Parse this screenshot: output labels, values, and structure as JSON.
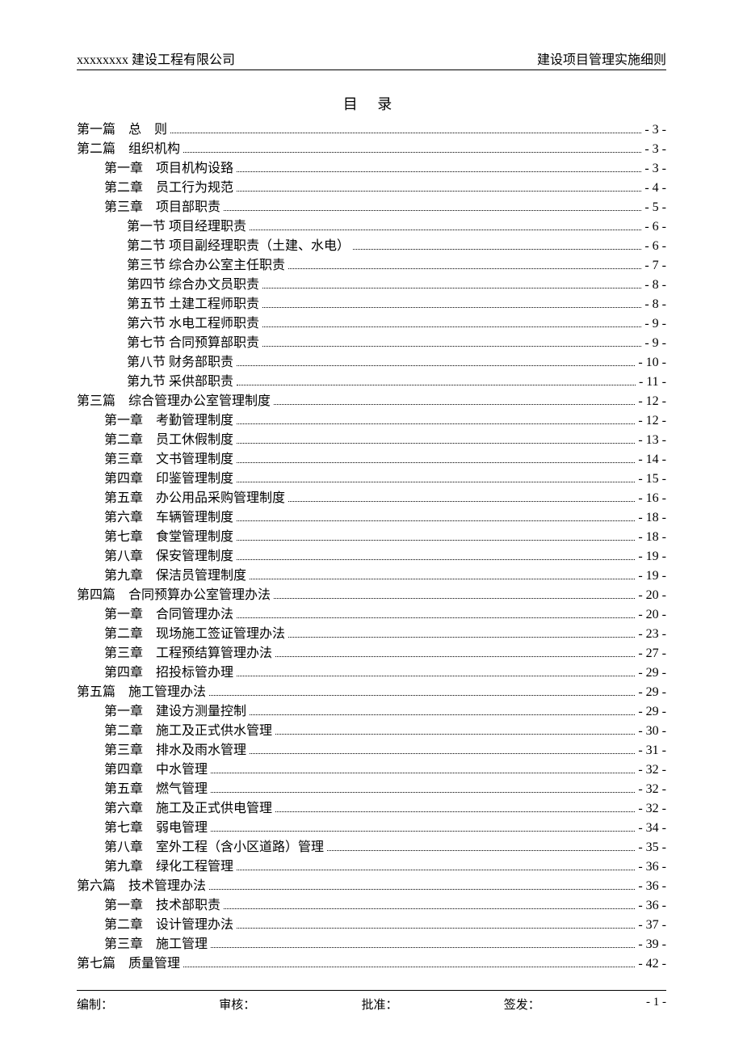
{
  "header": {
    "left": "xxxxxxxx 建设工程有限公司",
    "right": "建设项目管理实施细则"
  },
  "title": "目  录",
  "toc": [
    {
      "indent": 0,
      "label": "第一篇　总　则 ",
      "page": "- 3 -"
    },
    {
      "indent": 0,
      "label": "第二篇　组织机构 ",
      "page": "- 3 -"
    },
    {
      "indent": 1,
      "label": "第一章　项目机构设臵 ",
      "page": " - 3 -"
    },
    {
      "indent": 1,
      "label": "第二章　员工行为规范 ",
      "page": " - 4 -"
    },
    {
      "indent": 1,
      "label": "第三章　项目部职责 ",
      "page": " - 5 -"
    },
    {
      "indent": 2,
      "label": "第一节  项目经理职责  ",
      "page": " - 6 -"
    },
    {
      "indent": 2,
      "label": "第二节  项目副经理职责（土建、水电）  ",
      "page": " - 6 -"
    },
    {
      "indent": 2,
      "label": "第三节  综合办公室主任职责  ",
      "page": " - 7 -"
    },
    {
      "indent": 2,
      "label": "第四节  综合办文员职责  ",
      "page": " - 8 -"
    },
    {
      "indent": 2,
      "label": "第五节  土建工程师职责  ",
      "page": " - 8 -"
    },
    {
      "indent": 2,
      "label": "第六节  水电工程师职责  ",
      "page": " - 9 -"
    },
    {
      "indent": 2,
      "label": "第七节  合同预算部职责  ",
      "page": " - 9 -"
    },
    {
      "indent": 2,
      "label": "第八节  财务部职责  ",
      "page": " - 10 -"
    },
    {
      "indent": 2,
      "label": "第九节  采供部职责  ",
      "page": "- 11 -"
    },
    {
      "indent": 0,
      "label": "第三篇　综合管理办公室管理制度 ",
      "page": "- 12 -"
    },
    {
      "indent": 1,
      "label": "第一章　考勤管理制度 ",
      "page": " - 12 -"
    },
    {
      "indent": 1,
      "label": "第二章　员工休假制度 ",
      "page": " - 13 -"
    },
    {
      "indent": 1,
      "label": "第三章　文书管理制度 ",
      "page": " - 14 -"
    },
    {
      "indent": 1,
      "label": "第四章　印鉴管理制度 ",
      "page": " - 15 -"
    },
    {
      "indent": 1,
      "label": "第五章　办公用品采购管理制度 ",
      "page": " - 16 -"
    },
    {
      "indent": 1,
      "label": "第六章　车辆管理制度 ",
      "page": " - 18 -"
    },
    {
      "indent": 1,
      "label": "第七章　食堂管理制度 ",
      "page": " - 18 -"
    },
    {
      "indent": 1,
      "label": "第八章　保安管理制度 ",
      "page": " - 19 -"
    },
    {
      "indent": 1,
      "label": "第九章　保洁员管理制度 ",
      "page": " - 19 -"
    },
    {
      "indent": 0,
      "label": "第四篇　合同预算办公室管理办法 ",
      "page": "- 20 -"
    },
    {
      "indent": 1,
      "label": "第一章　合同管理办法 ",
      "page": " - 20 -"
    },
    {
      "indent": 1,
      "label": "第二章　现场施工签证管理办法 ",
      "page": " - 23 -"
    },
    {
      "indent": 1,
      "label": "第三章　工程预结算管理办法 ",
      "page": " - 27 -"
    },
    {
      "indent": 1,
      "label": "第四章　招投标管办理 ",
      "page": " - 29 -"
    },
    {
      "indent": 0,
      "label": "第五篇　施工管理办法 ",
      "page": "- 29 -"
    },
    {
      "indent": 1,
      "label": "第一章　建设方测量控制 ",
      "page": " - 29 -"
    },
    {
      "indent": 1,
      "label": "第二章　施工及正式供水管理 ",
      "page": " - 30 -"
    },
    {
      "indent": 1,
      "label": "第三章　排水及雨水管理 ",
      "page": " - 31 -"
    },
    {
      "indent": 1,
      "label": "第四章　中水管理 ",
      "page": " - 32 -"
    },
    {
      "indent": 1,
      "label": "第五章　燃气管理 ",
      "page": " - 32 -"
    },
    {
      "indent": 1,
      "label": "第六章　施工及正式供电管理 ",
      "page": " - 32 -"
    },
    {
      "indent": 1,
      "label": "第七章　弱电管理 ",
      "page": " - 34 -"
    },
    {
      "indent": 1,
      "label": "第八章　室外工程（含小区道路）管理 ",
      "page": " - 35 -"
    },
    {
      "indent": 1,
      "label": "第九章　绿化工程管理 ",
      "page": " - 36 -"
    },
    {
      "indent": 0,
      "label": "第六篇　技术管理办法 ",
      "page": "- 36 -"
    },
    {
      "indent": 1,
      "label": "第一章　技术部职责 ",
      "page": " - 36 -"
    },
    {
      "indent": 1,
      "label": "第二章　设计管理办法 ",
      "page": " - 37 -"
    },
    {
      "indent": 1,
      "label": "第三章　施工管理 ",
      "page": " - 39 -"
    },
    {
      "indent": 0,
      "label": "第七篇　质量管理 ",
      "page": "- 42 -"
    }
  ],
  "footer": {
    "f1": "编制：",
    "f2": "审核：",
    "f3": "批准：",
    "f4": "签发：",
    "pageno": "- 1 -"
  }
}
